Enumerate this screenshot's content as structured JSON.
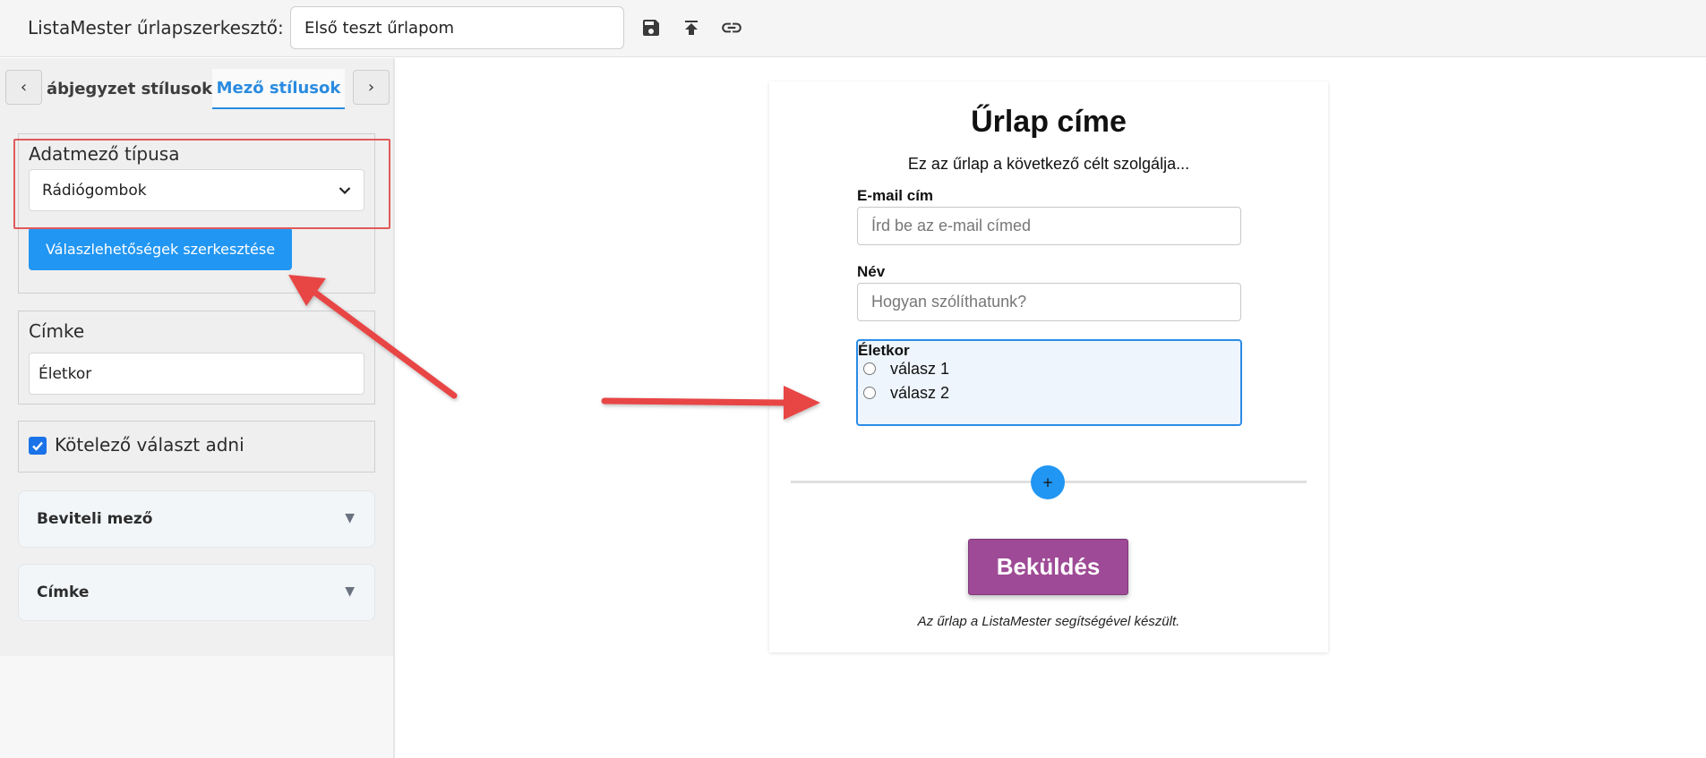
{
  "header": {
    "app_title": "ListaMester űrlapszerkesztő:",
    "form_name_value": "Első teszt űrlapom",
    "icons": [
      "save-icon",
      "upload-icon",
      "link-icon"
    ]
  },
  "sidebar": {
    "tab_prev": "‹",
    "tab_next": "›",
    "tabs": [
      {
        "label": "ábjegyzet stílusok",
        "active": false
      },
      {
        "label": "Mező stílusok",
        "active": true
      }
    ],
    "field_type": {
      "label": "Adatmező típusa",
      "selected": "Rádiógombok"
    },
    "edit_options_label": "Válaszlehetőségek szerkesztése",
    "label_field": {
      "label": "Címke",
      "value": "Életkor"
    },
    "required": {
      "label": "Kötelező választ adni",
      "checked": true
    },
    "accordions": [
      {
        "label": "Beviteli mező"
      },
      {
        "label": "Címke"
      }
    ]
  },
  "form": {
    "title": "Űrlap címe",
    "description": "Ez az űrlap a következő célt szolgálja...",
    "fields": [
      {
        "label": "E-mail cím",
        "placeholder": "Írd be az e-mail címed"
      },
      {
        "label": "Név",
        "placeholder": "Hogyan szólíthatunk?"
      }
    ],
    "radio_field": {
      "label": "Életkor",
      "options": [
        "válasz 1",
        "válasz 2"
      ]
    },
    "add_field_symbol": "+",
    "submit_label": "Beküldés",
    "footer_note": "Az űrlap a ListaMester segítségével készült."
  },
  "colors": {
    "accent_blue": "#2196f3",
    "submit_purple": "#9e4a96",
    "annotation_red": "#e84545",
    "active_tab": "#2a8be0"
  }
}
